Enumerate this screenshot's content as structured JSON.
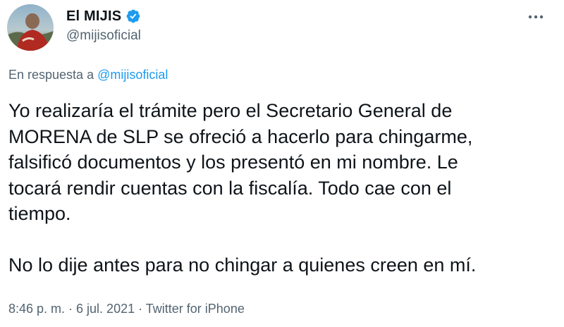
{
  "author": {
    "display_name": "El MIJIS",
    "handle": "@mijisoficial",
    "verified": true
  },
  "reply": {
    "prefix": "En respuesta a",
    "mention": "@mijisoficial"
  },
  "tweet": {
    "paragraph_1": "Yo realizaría el trámite pero el Secretario General de\nMORENA de SLP se ofreció a hacerlo para chingarme,\nfalsificó documentos y los presentó en mi nombre. Le\ntocará rendir cuentas con la fiscalía. Todo cae con el\ntiempo.",
    "paragraph_2": "No lo dije antes para no chingar a quienes creen en mí."
  },
  "meta": {
    "time_date_source": "8:46 p. m. · 6 jul. 2021 · Twitter for iPhone"
  },
  "icons": {
    "more": "more-horizontal-icon",
    "verified": "verified-badge-icon"
  },
  "colors": {
    "accent": "#1d9bf0",
    "text": "#0f1419",
    "secondary": "#536471"
  }
}
